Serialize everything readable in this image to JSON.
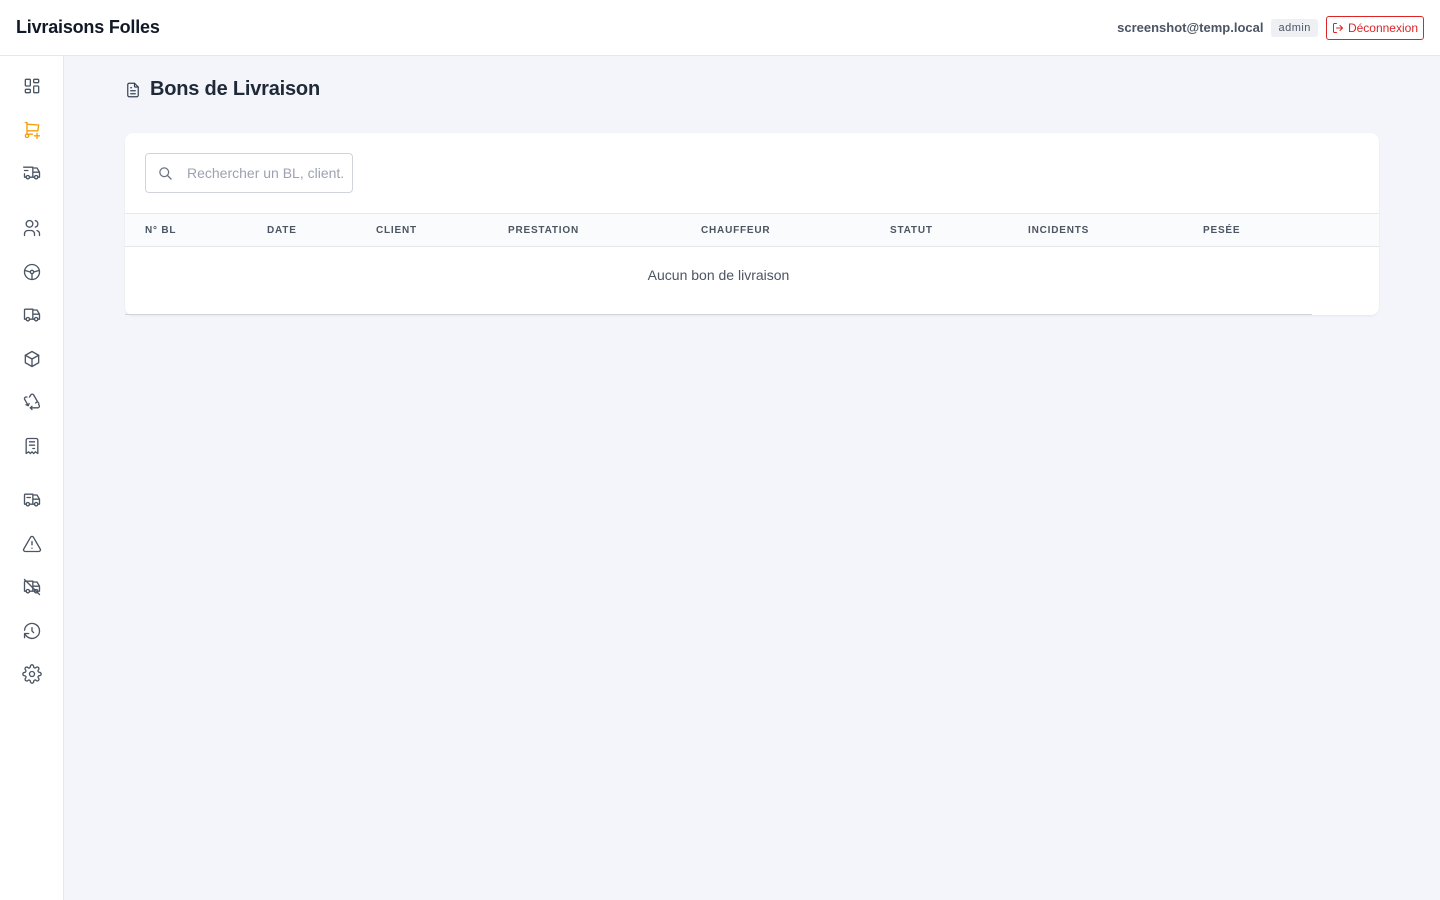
{
  "header": {
    "brand": "Livraisons Folles",
    "user_email": "screenshot@temp.local",
    "role": "admin",
    "logout_label": "Déconnexion"
  },
  "sidebar": {
    "items": [
      {
        "icon": "dashboard-icon",
        "active": false
      },
      {
        "icon": "cart-plus-icon",
        "active": true
      },
      {
        "icon": "delivery-truck-icon",
        "active": false
      },
      {
        "icon": "users-icon",
        "active": false
      },
      {
        "icon": "steering-wheel-icon",
        "active": false
      },
      {
        "icon": "truck-icon",
        "active": false
      },
      {
        "icon": "package-icon",
        "active": false
      },
      {
        "icon": "recycle-icon",
        "active": false
      },
      {
        "icon": "receipt-icon",
        "active": false
      },
      {
        "icon": "truck-loaded-icon",
        "active": false
      },
      {
        "icon": "warning-icon",
        "active": false
      },
      {
        "icon": "truck-off-icon",
        "active": false
      },
      {
        "icon": "history-icon",
        "active": false
      },
      {
        "icon": "gear-icon",
        "active": false
      }
    ]
  },
  "page": {
    "title": "Bons de Livraison",
    "search_placeholder": "Rechercher un BL, client...",
    "columns": [
      "N° BL",
      "Date",
      "Client",
      "Prestation",
      "Chauffeur",
      "Statut",
      "Incidents",
      "Pesée"
    ],
    "empty_text": "Aucun bon de livraison"
  },
  "colors": {
    "accent": "#f59e0b",
    "danger": "#dc2626",
    "background": "#f3f5fa"
  }
}
